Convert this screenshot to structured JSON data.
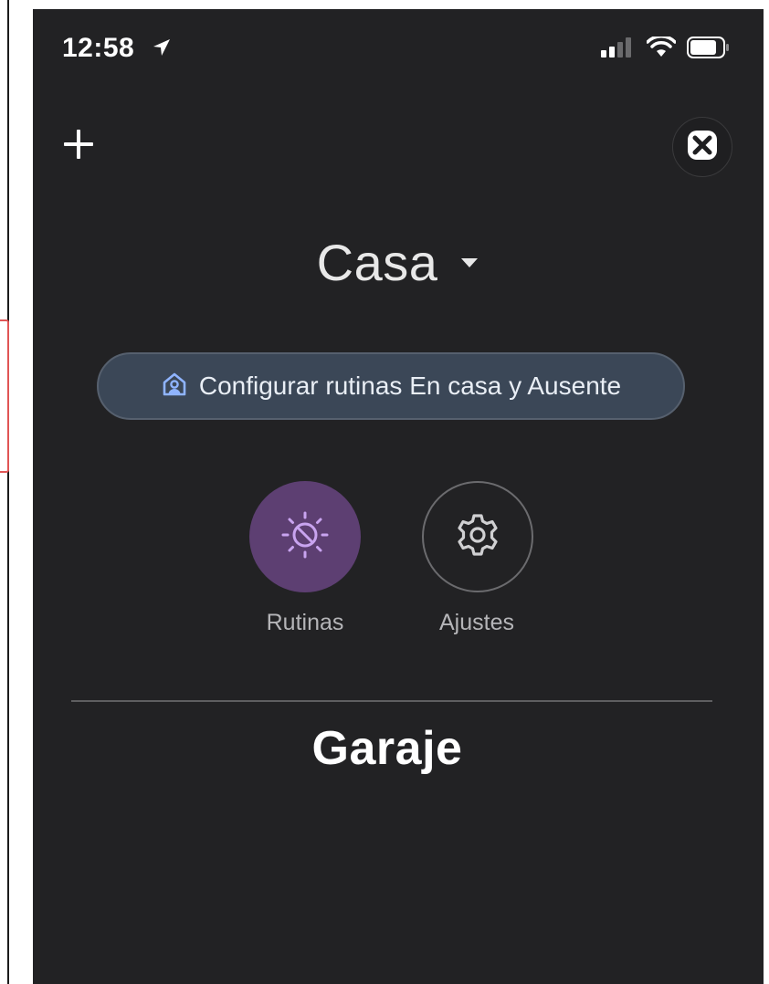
{
  "status_bar": {
    "time": "12:58",
    "icons": [
      "location-arrow-icon",
      "cellular-signal-icon",
      "wifi-icon",
      "battery-icon"
    ]
  },
  "toolbar": {
    "add_icon": "plus-icon",
    "close_icon": "close-icon"
  },
  "home": {
    "name": "Casa",
    "dropdown_icon": "caret-down-icon"
  },
  "config_banner": {
    "icon": "home-person-icon",
    "label": "Configurar rutinas En casa y Ausente"
  },
  "actions": [
    {
      "label": "Rutinas",
      "icon": "routines-sun-icon"
    },
    {
      "label": "Ajustes",
      "icon": "gear-icon"
    }
  ],
  "section": {
    "title": "Garaje"
  },
  "colors": {
    "background": "#222224",
    "pill_background": "#3b4757",
    "routines_accent": "#5d3f72",
    "routines_icon": "#c9a4f0",
    "home_icon": "#8fb4ff"
  }
}
